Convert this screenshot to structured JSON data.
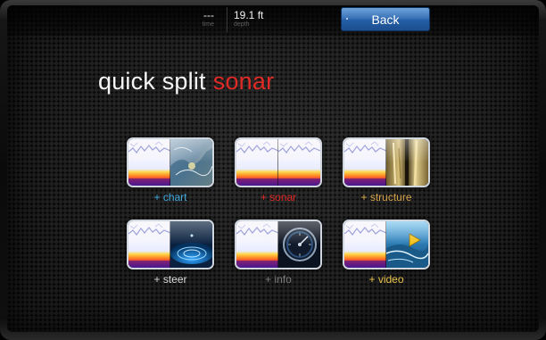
{
  "header": {
    "time": {
      "value": "---",
      "label": "time"
    },
    "depth": {
      "value": "19.1 ft",
      "label": "depth"
    },
    "back_label": "Back"
  },
  "title": {
    "prefix": "quick split",
    "mode": "sonar"
  },
  "colors": {
    "accent_red": "#e02a26",
    "chart": "#3fa9e0",
    "structure": "#d4a44a",
    "steer": "#d8d8d8",
    "info": "#7a7a7a",
    "video": "#e6c24a",
    "back_button": "#2f6bb0"
  },
  "tiles": [
    {
      "label": "+ chart",
      "icon": "chart-map-icon"
    },
    {
      "label": "+ sonar",
      "icon": "sonar-icon"
    },
    {
      "label": "+ structure",
      "icon": "structure-scan-icon"
    },
    {
      "label": "+ steer",
      "icon": "steer-waypoint-icon"
    },
    {
      "label": "+ info",
      "icon": "info-gauge-icon"
    },
    {
      "label": "+ video",
      "icon": "video-play-icon"
    }
  ]
}
